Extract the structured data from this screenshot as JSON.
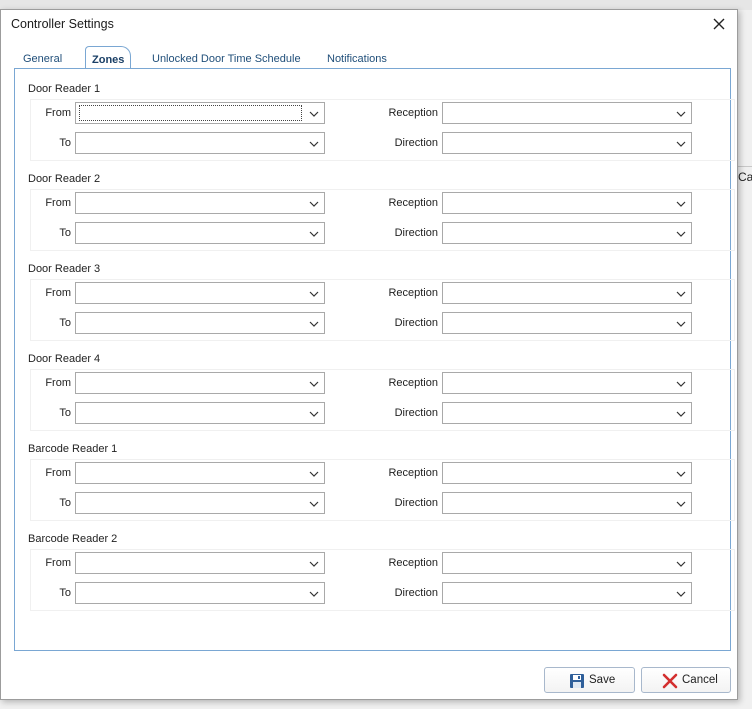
{
  "background": {
    "right_text": "Ca"
  },
  "dialog": {
    "title": "Controller Settings",
    "tabs": [
      {
        "label": "General",
        "active": false
      },
      {
        "label": "Zones",
        "active": true
      },
      {
        "label": "Unlocked Door Time Schedule",
        "active": false
      },
      {
        "label": "Notifications",
        "active": false
      }
    ],
    "groups": [
      {
        "title": "Door Reader 1",
        "from_label": "From",
        "to_label": "To",
        "reception_label": "Reception",
        "direction_label": "Direction",
        "from": "",
        "to": "",
        "reception": "",
        "direction": ""
      },
      {
        "title": "Door Reader 2",
        "from_label": "From",
        "to_label": "To",
        "reception_label": "Reception",
        "direction_label": "Direction",
        "from": "",
        "to": "",
        "reception": "",
        "direction": ""
      },
      {
        "title": "Door Reader 3",
        "from_label": "From",
        "to_label": "To",
        "reception_label": "Reception",
        "direction_label": "Direction",
        "from": "",
        "to": "",
        "reception": "",
        "direction": ""
      },
      {
        "title": "Door Reader 4",
        "from_label": "From",
        "to_label": "To",
        "reception_label": "Reception",
        "direction_label": "Direction",
        "from": "",
        "to": "",
        "reception": "",
        "direction": ""
      },
      {
        "title": "Barcode Reader 1",
        "from_label": "From",
        "to_label": "To",
        "reception_label": "Reception",
        "direction_label": "Direction",
        "from": "",
        "to": "",
        "reception": "",
        "direction": ""
      },
      {
        "title": "Barcode Reader 2",
        "from_label": "From",
        "to_label": "To",
        "reception_label": "Reception",
        "direction_label": "Direction",
        "from": "",
        "to": "",
        "reception": "",
        "direction": ""
      }
    ],
    "buttons": {
      "save": "Save",
      "cancel": "Cancel"
    },
    "colors": {
      "tab_border": "#7aa7d3",
      "tab_text": "#1f4e79",
      "cancel_icon": "#d32f2f",
      "save_icon": "#2f5f9a"
    }
  }
}
